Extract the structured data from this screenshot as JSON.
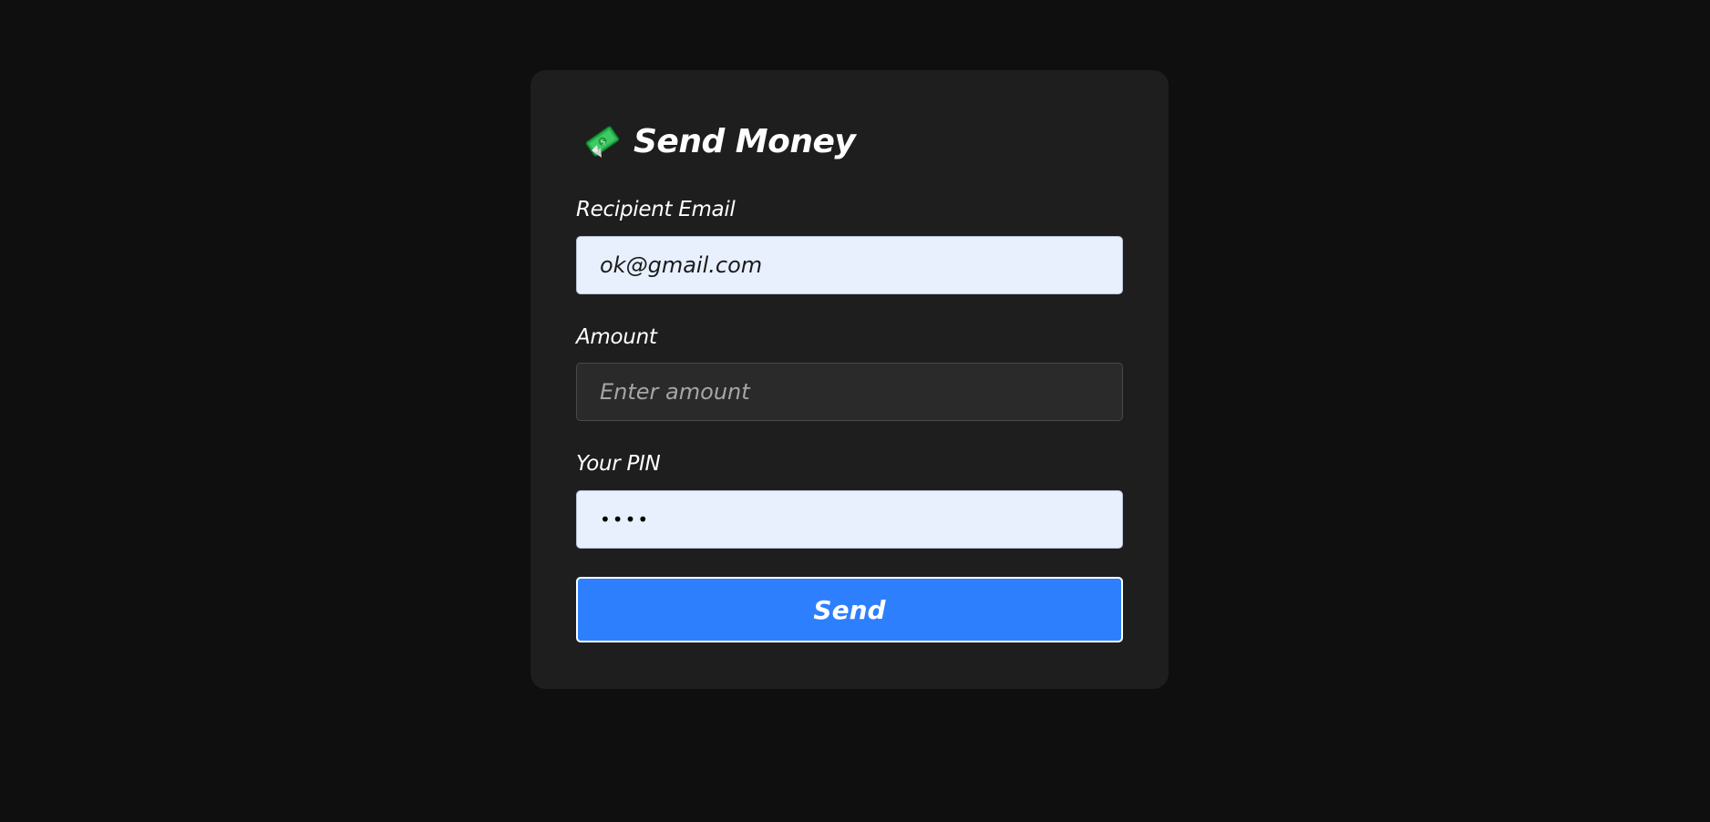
{
  "form": {
    "title": "Send Money",
    "icon": "money-with-wings-icon",
    "recipient_label": "Recipient Email",
    "recipient_value": "ok@gmail.com",
    "amount_label": "Amount",
    "amount_placeholder": "Enter amount",
    "amount_value": "",
    "pin_label": "Your PIN",
    "pin_value": "••••",
    "send_label": "Send"
  },
  "colors": {
    "page_background": "#0f0f0f",
    "card_background": "#1e1e1e",
    "filled_input_background": "#e8f0fe",
    "empty_input_background": "#2a2a2a",
    "button_background": "#2d7ffe",
    "text": "#ffffff"
  }
}
